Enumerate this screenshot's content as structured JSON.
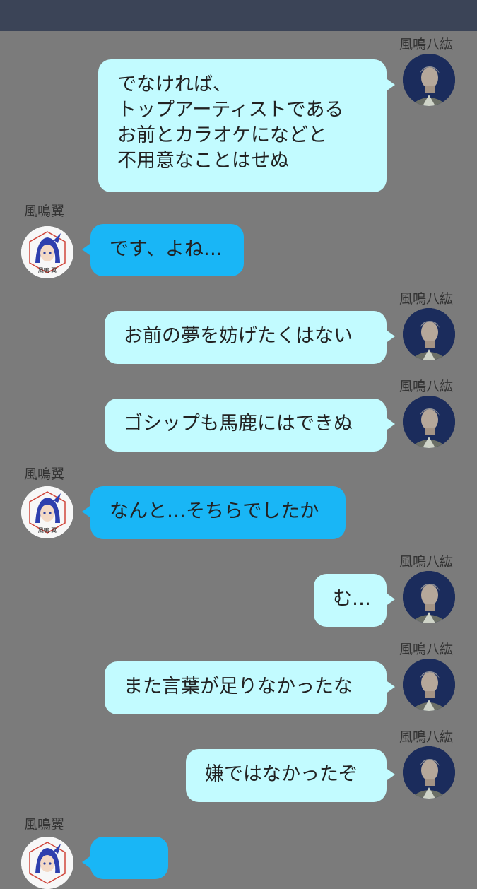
{
  "colors": {
    "background": "#7b7b7b",
    "topbar": "#3b4457",
    "sent_bubble": "#c2fbff",
    "received_bubble": "#19b6f6"
  },
  "participants": {
    "yatsuhiro": {
      "name": "風鳴八紘",
      "avatar": "yatsuhiro-portrait-icon"
    },
    "tsubasa": {
      "name": "風鳴翼",
      "avatar": "tsubasa-portrait-icon",
      "badge": "風鳴 翼"
    }
  },
  "messages": [
    {
      "speaker": "風鳴八紘",
      "side": "right",
      "text": "でなければ、\nトップアーティストである\nお前とカラオケになどと\n不用意なことはせぬ"
    },
    {
      "speaker": "風鳴翼",
      "side": "left",
      "text": "です、よね…"
    },
    {
      "speaker": "風鳴八紘",
      "side": "right",
      "text": "お前の夢を妨げたくはない"
    },
    {
      "speaker": "風鳴八紘",
      "side": "right",
      "text": "ゴシップも馬鹿にはできぬ"
    },
    {
      "speaker": "風鳴翼",
      "side": "left",
      "text": "なんと…そちらでしたか"
    },
    {
      "speaker": "風鳴八紘",
      "side": "right",
      "text": "む…"
    },
    {
      "speaker": "風鳴八紘",
      "side": "right",
      "text": "また言葉が足りなかったな"
    },
    {
      "speaker": "風鳴八紘",
      "side": "right",
      "text": "嫌ではなかったぞ"
    },
    {
      "speaker": "風鳴翼",
      "side": "left",
      "text": ""
    }
  ]
}
